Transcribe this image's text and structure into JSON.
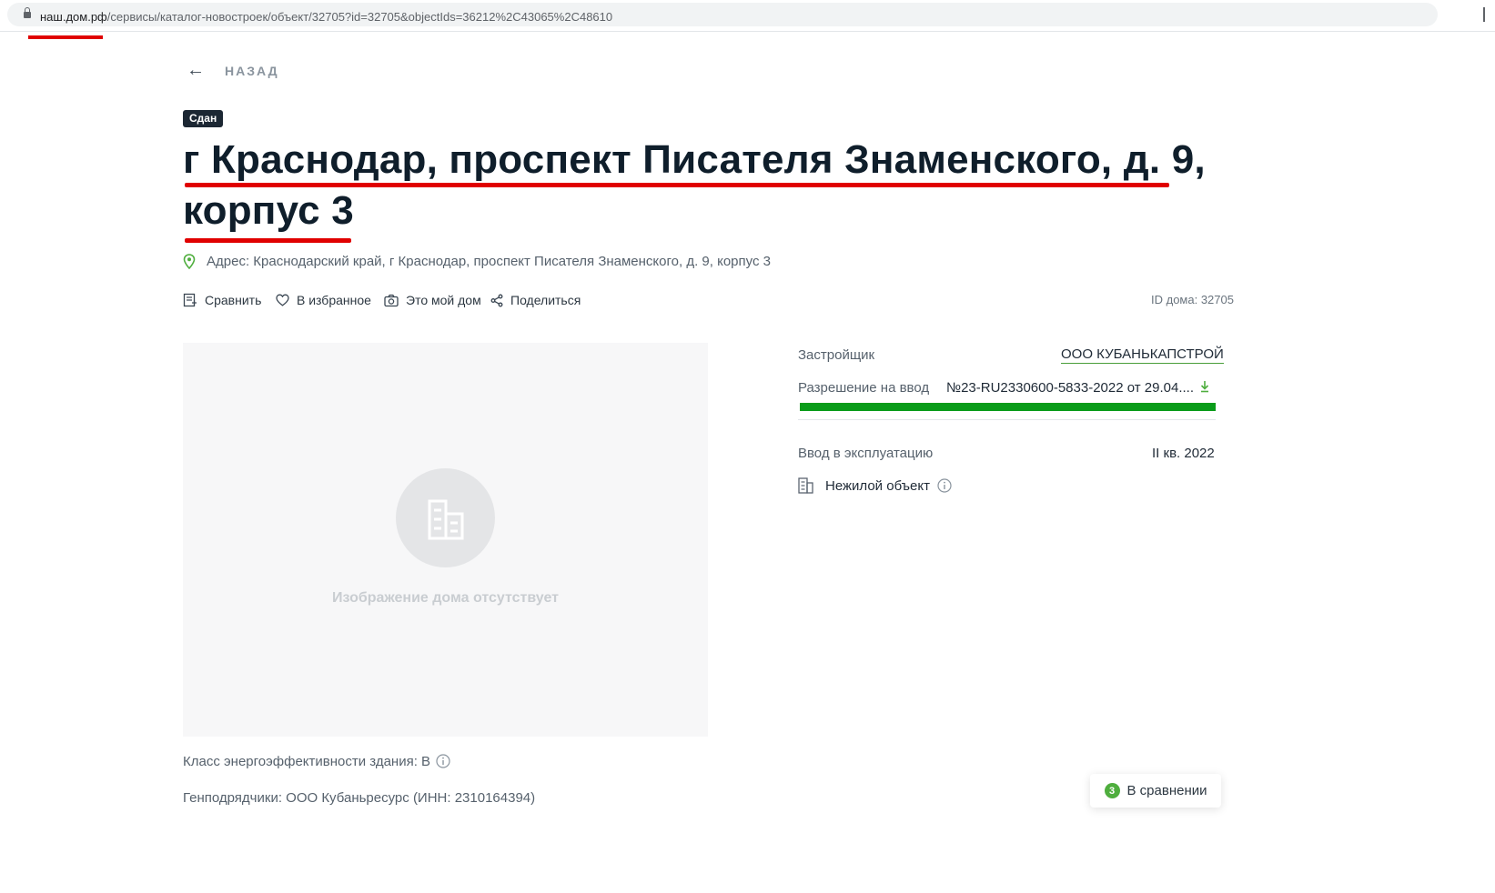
{
  "browser": {
    "url_domain": "наш.дом.рф",
    "url_path": "/сервисы/каталог-новостроек/объект/32705?id=32705&objectIds=36212%2C43065%2C48610"
  },
  "nav": {
    "back_icon": "arrow-left-icon",
    "back_label": "НАЗАД"
  },
  "object": {
    "status_badge": "Сдан",
    "title_line1": "г Краснодар, проспект Писателя Знаменского, д. 9,",
    "title_line2": "корпус 3",
    "address": "Адрес: Краснодарский край, г Краснодар, проспект Писателя Знаменского, д. 9, корпус 3",
    "house_id": "ID дома: 32705"
  },
  "actions": {
    "compare": "Сравнить",
    "favorite": "В избранное",
    "my_house": "Это мой дом",
    "share": "Поделиться"
  },
  "image_placeholder": {
    "caption": "Изображение дома отсутствует"
  },
  "details": {
    "developer_label": "Застройщик",
    "developer_value": "ООО КУБАНЬКАПСТРОЙ",
    "permit_label": "Разрешение на ввод",
    "permit_value": "№23-RU2330600-5833-2022 от 29.04....",
    "commissioning_label": "Ввод в эксплуатацию",
    "commissioning_value": "II кв. 2022",
    "object_type": "Нежилой объект"
  },
  "footer_info": {
    "energy_class": "Класс энергоэффективности здания: В",
    "general_contractors": "Генподрядчики: ООО Кубаньресурс (ИНН: 2310164394)"
  },
  "compare_widget": {
    "count": "3",
    "label": "В сравнении"
  },
  "colors": {
    "accent_green": "#4fae3e",
    "highlight_red": "#e00000",
    "highlight_green": "#0a9c1a",
    "badge_dark": "#1c2733"
  }
}
